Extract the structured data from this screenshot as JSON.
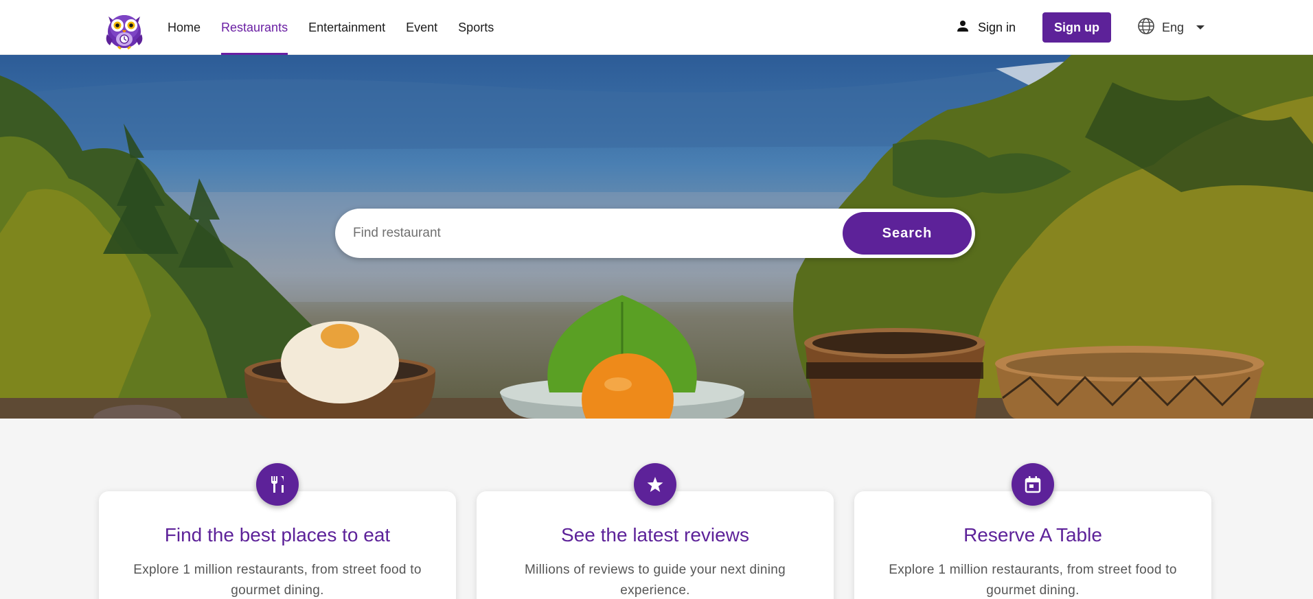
{
  "header": {
    "logo_icon": "owl-logo-icon",
    "nav": [
      {
        "label": "Home",
        "active": false
      },
      {
        "label": "Restaurants",
        "active": true
      },
      {
        "label": "Entertainment",
        "active": false
      },
      {
        "label": "Event",
        "active": false
      },
      {
        "label": "Sports",
        "active": false
      }
    ],
    "signin_label": "Sign in",
    "signin_icon": "person-icon",
    "signup_label": "Sign up",
    "language_label": "Eng",
    "language_icon": "globe-icon"
  },
  "search": {
    "placeholder": "Find restaurant",
    "value": "",
    "button_label": "Search"
  },
  "features": [
    {
      "icon": "fork-knife-icon",
      "title": "Find the best places to eat",
      "description": "Explore 1 million restaurants, from street food to gourmet dining."
    },
    {
      "icon": "star-icon",
      "title": "See the latest reviews",
      "description": "Millions of reviews to guide your next dining experience."
    },
    {
      "icon": "calendar-icon",
      "title": "Reserve A Table",
      "description": "Explore 1 million restaurants, from street food to gourmet dining."
    }
  ],
  "colors": {
    "brand": "#5d2299",
    "nav_active": "#6a1fa3",
    "background": "#f5f5f5"
  }
}
